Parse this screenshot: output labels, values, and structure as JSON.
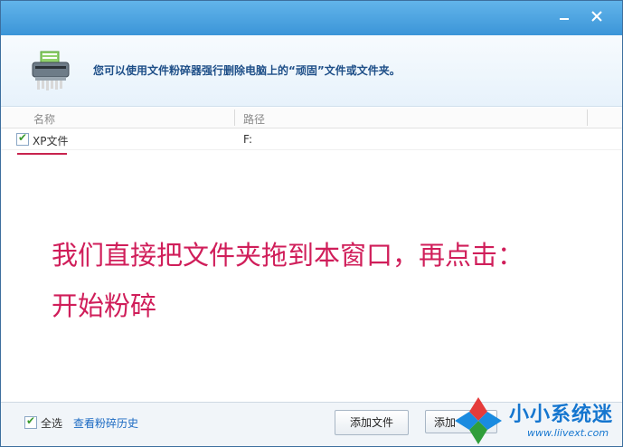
{
  "window": {
    "minimize_icon": "minimize-icon",
    "close_icon": "close-icon"
  },
  "header": {
    "icon": "shredder-icon",
    "description": "您可以使用文件粉碎器强行删除电脑上的“顽固”文件或文件夹。"
  },
  "file_list": {
    "columns": [
      "名称",
      "路径"
    ],
    "rows": [
      {
        "checked": true,
        "name": "XP文件",
        "path": "F:"
      }
    ]
  },
  "annotation": {
    "line1": "我们直接把文件夹拖到本窗口，再点击：",
    "line2": "开始粉碎",
    "color": "#d01e5a"
  },
  "footer": {
    "select_all_checked": true,
    "select_all_label": "全选",
    "history_link": "查看粉碎历史",
    "add_file_button": "添加文件",
    "add_folder_button": "添加"
  },
  "watermark": {
    "text": "小小系统迷",
    "url": "www.liivext.com"
  },
  "colors": {
    "title_bar": "#4aa6e3",
    "header_text": "#1e4f88",
    "link": "#1a69c2",
    "check": "#3a9a2e"
  }
}
